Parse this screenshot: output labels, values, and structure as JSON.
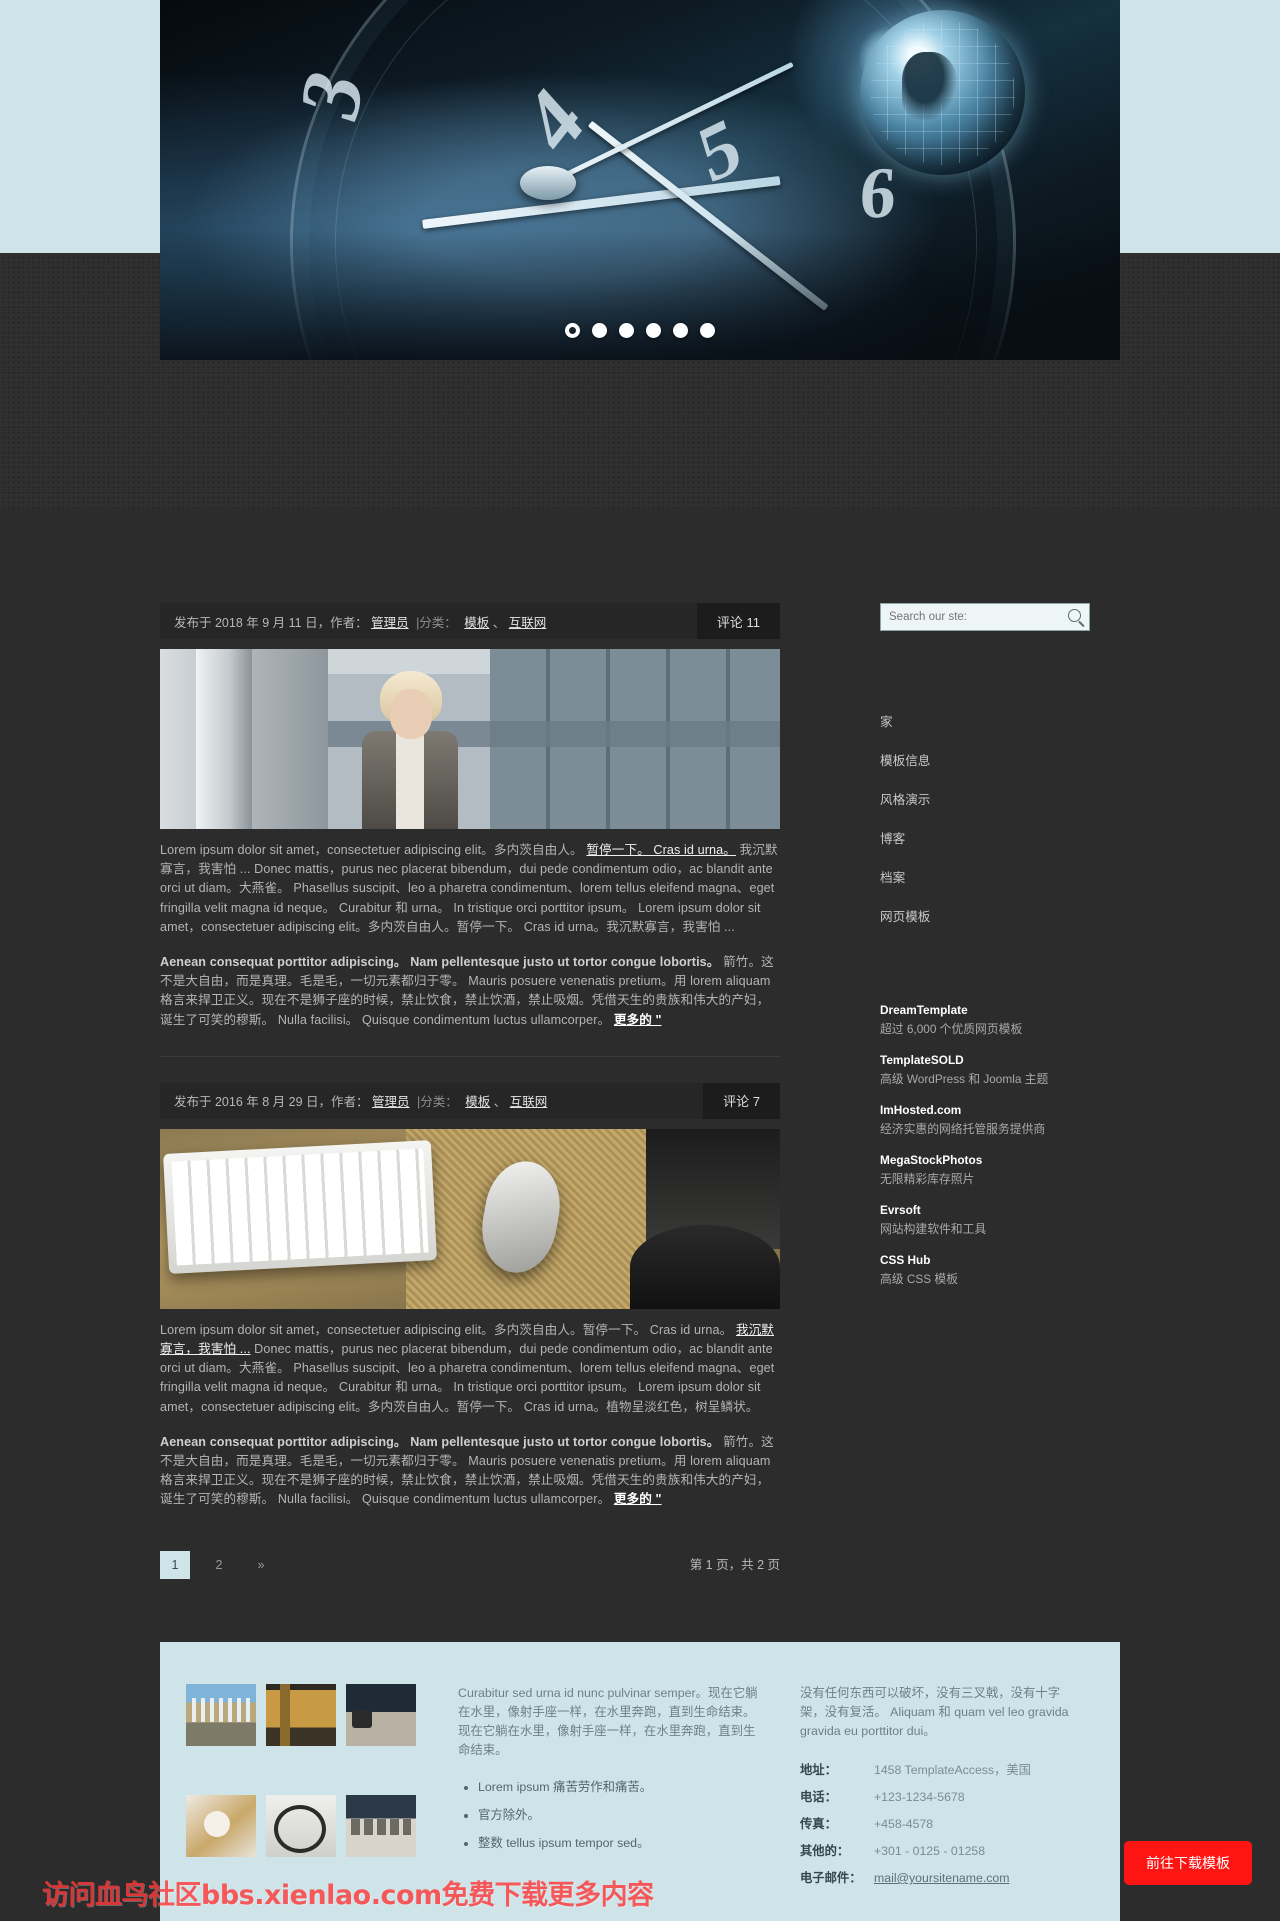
{
  "hero": {
    "dots": [
      "1",
      "2",
      "3",
      "4",
      "5",
      "6"
    ],
    "active_dot": 1
  },
  "sidebar": {
    "search": {
      "placeholder": "Search our ste:",
      "value": "",
      "icon": "search-icon"
    },
    "nav": [
      {
        "label": "家"
      },
      {
        "label": "模板信息"
      },
      {
        "label": "风格演示"
      },
      {
        "label": "博客"
      },
      {
        "label": "档案"
      },
      {
        "label": "网页模板"
      }
    ],
    "sponsors": [
      {
        "title": "DreamTemplate",
        "desc": "超过 6,000 个优质网页模板"
      },
      {
        "title": "TemplateSOLD",
        "desc": "高级 WordPress 和 Joomla 主题"
      },
      {
        "title": "ImHosted.com",
        "desc": "经济实惠的网络托管服务提供商"
      },
      {
        "title": "MegaStockPhotos",
        "desc": "无限精彩库存照片"
      },
      {
        "title": "Evrsoft",
        "desc": "网站构建软件和工具"
      },
      {
        "title": "CSS Hub",
        "desc": "高级 CSS 模板"
      }
    ]
  },
  "posts": [
    {
      "meta_prefix": "发布于 2018 年 9 月 11 日，作者：",
      "author": "管理员",
      "cat_label": "|分类：",
      "cat1": "模板",
      "cat_sep": "、",
      "cat2": "互联网",
      "comments": "评论 11",
      "image": "woman-outside-building-photo",
      "p1_a": "Lorem ipsum dolor sit amet，consectetuer adipiscing elit。多内茨自由人。",
      "p1_u": "暂停一下。 Cras id urna。",
      "p1_b": "我沉默寡言，我害怕 ... Donec mattis，purus nec placerat bibendum，dui pede condimentum odio，ac blandit ante orci ut diam。大燕雀。 Phasellus suscipit、leo a pharetra condimentum、lorem tellus eleifend magna、eget fringilla velit magna id neque。 Curabitur 和 urna。 In tristique orci porttitor ipsum。 Lorem ipsum dolor sit amet，consectetuer adipiscing elit。多内茨自由人。暂停一下。 Cras id urna。我沉默寡言，我害怕 ...",
      "p2_strong": "Aenean consequat porttitor adipiscing。 Nam pellentesque justo ut tortor congue lobortis。",
      "p2_rest": "箭竹。这不是大自由，而是真理。毛是毛，一切元素都归于零。 Mauris posuere venenatis pretium。用 lorem aliquam 格言来捍卫正义。现在不是狮子座的时候，禁止饮食，禁止饮酒，禁止吸烟。凭借天生的贵族和伟大的产妇，诞生了可笑的穆斯。 Nulla facilisi。 Quisque condimentum luctus ullamcorper。",
      "more": "更多的 \""
    },
    {
      "meta_prefix": "发布于 2016 年 8 月 29 日，作者：",
      "author": "管理员",
      "cat_label": "|分类：",
      "cat1": "模板",
      "cat_sep": "、",
      "cat2": "互联网",
      "comments": "评论 7",
      "image": "keyboard-and-mouse-desk-photo",
      "p1_a": "Lorem ipsum dolor sit amet，consectetuer adipiscing elit。多内茨自由人。暂停一下。 Cras id urna。",
      "p1_u": "我沉默寡言，我害怕 ...",
      "p1_b": "Donec mattis，purus nec placerat bibendum，dui pede condimentum odio，ac blandit ante orci ut diam。大燕雀。 Phasellus suscipit、leo a pharetra condimentum、lorem tellus eleifend magna、eget fringilla velit magna id neque。 Curabitur 和 urna。 In tristique orci porttitor ipsum。 Lorem ipsum dolor sit amet，consectetuer adipiscing elit。多内茨自由人。暂停一下。 Cras id urna。植物呈淡红色，树呈鳞状。",
      "p2_strong": "Aenean consequat porttitor adipiscing。 Nam pellentesque justo ut tortor congue lobortis。",
      "p2_rest": "箭竹。这不是大自由，而是真理。毛是毛，一切元素都归于零。 Mauris posuere venenatis pretium。用 lorem aliquam 格言来捍卫正义。现在不是狮子座的时候，禁止饮食，禁止饮酒，禁止吸烟。凭借天生的贵族和伟大的产妇，诞生了可笑的穆斯。 Nulla facilisi。 Quisque condimentum luctus ullamcorper。",
      "more": "更多的 \""
    }
  ],
  "pagination": {
    "pages": [
      "1",
      "2",
      "»"
    ],
    "active": "1",
    "info": "第 1 页，共 2 页"
  },
  "footer": {
    "gallery": [
      "city-skyline-thumb",
      "autumn-trees-thumb",
      "desert-road-thumb",
      "flowers-thumb",
      "motorcycle-thumb",
      "velvet-drop-thumb"
    ],
    "middle_text": "Curabitur sed urna id nunc pulvinar semper。现在它躺在水里，像射手座一样，在水里奔跑，直到生命结束。现在它躺在水里，像射手座一样，在水里奔跑，直到生命结束。",
    "bullets": [
      "Lorem ipsum 痛苦劳作和痛苦。",
      "官方除外。",
      "整数 tellus ipsum tempor sed。"
    ],
    "right_text": "没有任何东西可以破坏，没有三叉戟，没有十字架，没有复活。 Aliquam 和 quam vel leo gravida gravida eu porttitor dui。",
    "contacts": [
      {
        "key": "地址：",
        "value": "1458 TemplateAccess，美国",
        "link": false
      },
      {
        "key": "电话：",
        "value": "+123-1234-5678",
        "link": false
      },
      {
        "key": "传真：",
        "value": "+458-4578",
        "link": false
      },
      {
        "key": "其他的：",
        "value": "+301 - 0125 - 01258",
        "link": false
      },
      {
        "key": "电子邮件：",
        "value": "mail@yoursitename.com",
        "link": true
      }
    ]
  },
  "overlay": {
    "watermark": "访问血鸟社区bbs.xienlao.com免费下载更多内容",
    "download_button": "前往下载模板",
    "accent_red": "#ff1414",
    "accent_light": "#cfe4e9",
    "page_bg": "#2c2c2c"
  }
}
